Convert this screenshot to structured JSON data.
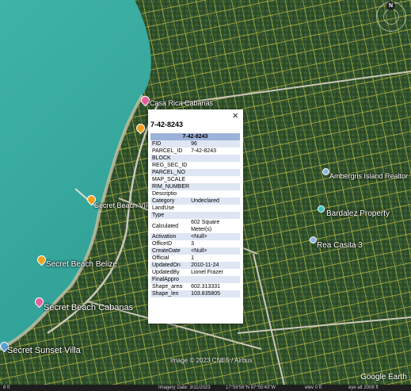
{
  "popup": {
    "title": "7-42-8243",
    "close": "×",
    "header": "7-42-8243",
    "rows": [
      {
        "k": "FID",
        "v": "96"
      },
      {
        "k": "PARCEL_ID",
        "v": "7-42-8243"
      },
      {
        "k": "BLOCK",
        "v": ""
      },
      {
        "k": "REG_SEC_ID",
        "v": ""
      },
      {
        "k": "PARCEL_NO",
        "v": ""
      },
      {
        "k": "MAP_SCALE",
        "v": ""
      },
      {
        "k": "RIM_NUMBER",
        "v": ""
      },
      {
        "k": "Descriptio",
        "v": ""
      },
      {
        "k": "Category",
        "v": "Undeclared"
      },
      {
        "k": "LandUse",
        "v": ""
      },
      {
        "k": "Type",
        "v": ""
      },
      {
        "k": "Calculated",
        "v": "602 Square Meter(s)"
      },
      {
        "k": "Activation",
        "v": "<Null>"
      },
      {
        "k": "OfficeID",
        "v": "3"
      },
      {
        "k": "CreateDate",
        "v": "<Null>"
      },
      {
        "k": "Official",
        "v": "1"
      },
      {
        "k": "UpdatedOn",
        "v": "2010-11-24"
      },
      {
        "k": "UpdatedBy",
        "v": "Lionel Frazer"
      },
      {
        "k": "FinalAppro",
        "v": ""
      },
      {
        "k": "Shape_area",
        "v": "602.313331"
      },
      {
        "k": "Shape_len",
        "v": "103.835805"
      }
    ]
  },
  "places": {
    "casa_cabanas": "Casa Rica Cabanas",
    "secret_beach_vip": "Secret Beach VIP",
    "secret_beach_belize": "Secret Beach Belize",
    "secret_beach_cabanas": "Secret Beach Cabanas",
    "secret_sunset_villa": "Secret Sunset Villa",
    "ambergris_realtor": "Ambergris Island Realtor",
    "bardalez_property": "Bardalez Property",
    "rea_casita": "Rea Casita 3"
  },
  "compass": {
    "n": "N"
  },
  "credit": "Image © 2023 CNES / Airbus",
  "google_logo": "Google Earth",
  "status": {
    "scale": "8 ft",
    "date": "Imagery Date: 3/11/2023",
    "coords": "17°59'56\"N 87°55'43\"W",
    "elev": "elev 0 ft",
    "eye": "eye alt 2008 ft"
  },
  "colors": {
    "sea": "#2f9e95",
    "land": "#3a5a33",
    "parcel_lines": "#e6e04a",
    "pin_orange": "#f0a020",
    "pin_pink": "#e0609a",
    "pin_blue": "#5aa0d8",
    "table_header": "#9cb3d9",
    "table_odd": "#dfe6f3"
  }
}
